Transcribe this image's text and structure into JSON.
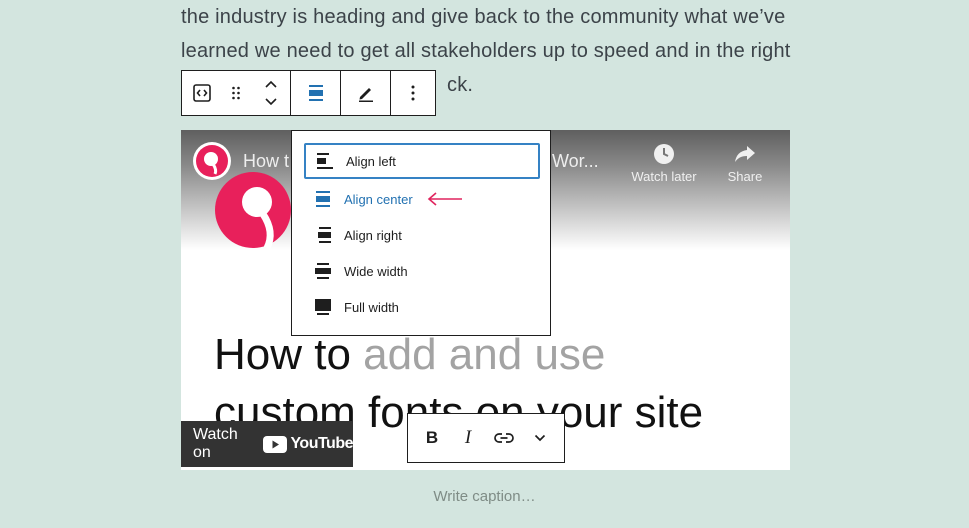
{
  "paragraph": {
    "line1": "the industry is heading and give back to the community what we’ve",
    "line2": "learned we need to get all stakeholders up to speed and in the right",
    "line3_visible": "ck."
  },
  "block_toolbar": {
    "icons": [
      "embed-block-icon",
      "drag-handle-icon",
      "move-up-down-icon",
      "align-center-icon",
      "edit-pencil-icon",
      "more-options-icon"
    ]
  },
  "align_menu": {
    "items": [
      {
        "label": "Align left",
        "icon": "align-left-icon",
        "state": "focused"
      },
      {
        "label": "Align center",
        "icon": "align-center-icon",
        "state": "active"
      },
      {
        "label": "Align right",
        "icon": "align-right-icon",
        "state": ""
      },
      {
        "label": "Wide width",
        "icon": "wide-width-icon",
        "state": ""
      },
      {
        "label": "Full width",
        "icon": "full-width-icon",
        "state": ""
      }
    ],
    "arrow_color": "#e0245e"
  },
  "video": {
    "title_left": "How t",
    "title_right": "ur Wor...",
    "watch_later": "Watch later",
    "share": "Share",
    "headline_dark1": "How to ",
    "headline_muted": "add and use",
    "headline_line2": "custom fonts on your site",
    "watch_on": "Watch on",
    "youtube": "YouTube",
    "brand_color": "#e8205b"
  },
  "format_toolbar": {
    "bold": "B",
    "italic": "I"
  },
  "caption": {
    "placeholder": "Write caption…"
  },
  "colors": {
    "background": "#d3e5df",
    "accent_blue": "#2271b1"
  }
}
